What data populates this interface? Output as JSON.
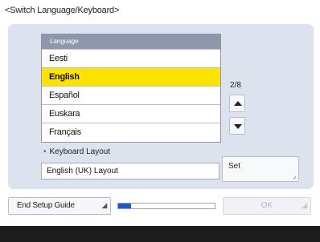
{
  "title": "<Switch Language/Keyboard>",
  "language_list": {
    "header": "Language",
    "items": [
      "Eesti",
      "English",
      "Español",
      "Euskara",
      "Français"
    ],
    "selected_index": 1
  },
  "pagination": {
    "indicator": "2/8"
  },
  "keyboard": {
    "label": "Keyboard Layout",
    "value": "English (UK) Layout",
    "set_label": "Set"
  },
  "bottom": {
    "end_setup_label": "End Setup Guide",
    "progress_fraction": 0.13,
    "ok_label": "OK"
  },
  "colors": {
    "selected_row": "#ffe200",
    "panel": "#dde2ef",
    "progress": "#1f58c8"
  }
}
